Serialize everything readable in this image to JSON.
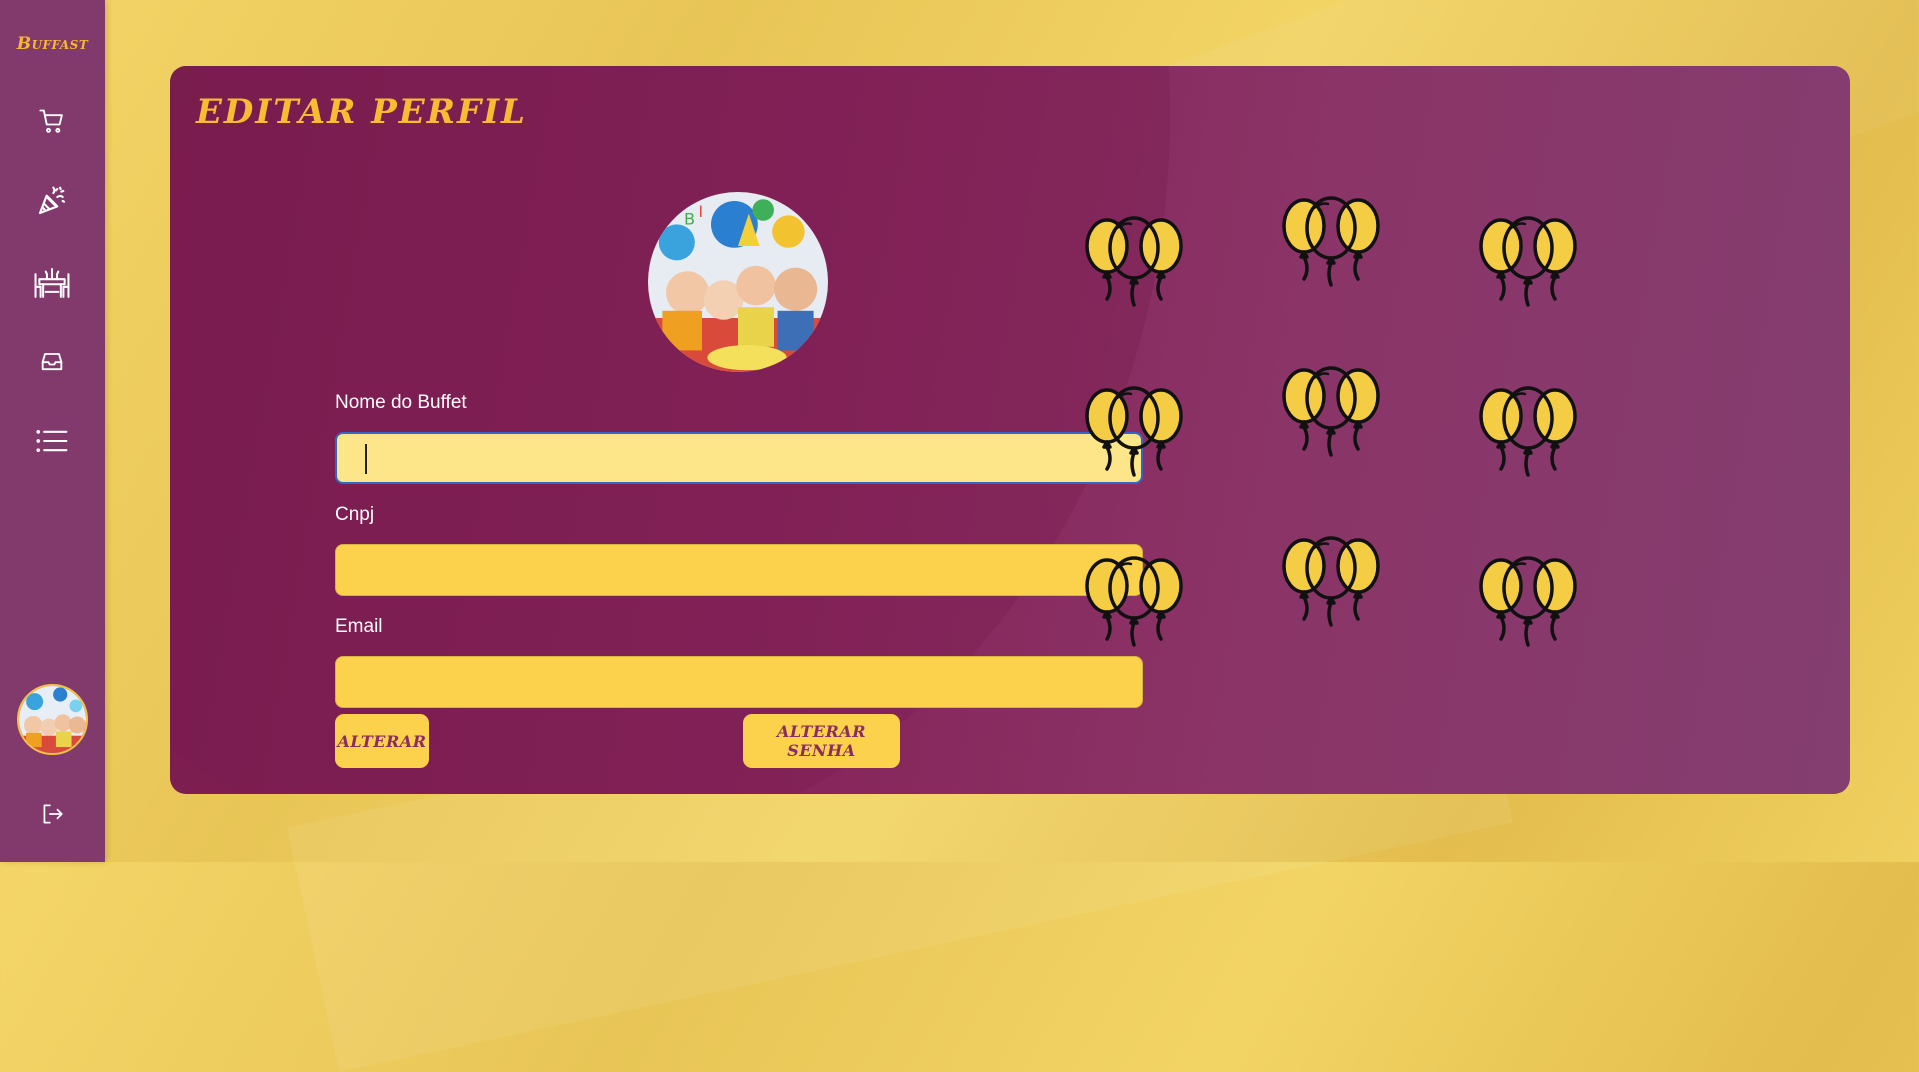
{
  "app": {
    "logo": "Buffast"
  },
  "sidebar": {
    "items": [
      {
        "name": "cart",
        "icon": "cart-icon"
      },
      {
        "name": "party",
        "icon": "party-popper-icon"
      },
      {
        "name": "venue",
        "icon": "dining-table-icon"
      },
      {
        "name": "inbox",
        "icon": "inbox-icon"
      },
      {
        "name": "menu",
        "icon": "list-icon"
      }
    ],
    "logout_icon": "logout-icon"
  },
  "page": {
    "title": "Editar Perfil"
  },
  "form": {
    "name_label": "Nome do Buffet",
    "name_value": "",
    "cnpj_label": "Cnpj",
    "cnpj_value": "",
    "email_label": "Email",
    "email_value": "",
    "alterar_label": "Alterar",
    "alterar_senha_label": "Alterar Senha"
  },
  "colors": {
    "primary": "#823a6c",
    "accent": "#fcd24d",
    "title": "#f7bc32",
    "balloon": "#f5cd45"
  },
  "decoration": {
    "balloon_icon": "balloons-icon"
  }
}
